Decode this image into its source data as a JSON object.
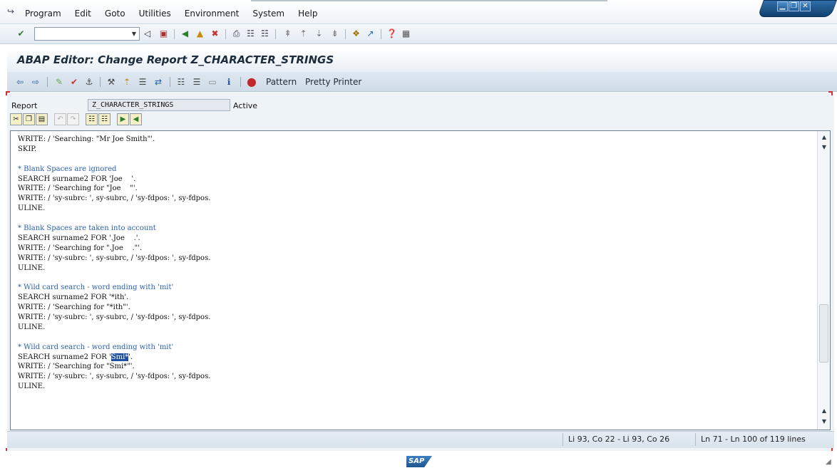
{
  "menubar": {
    "icon": "menu-exit-icon",
    "items": [
      {
        "label": "Program"
      },
      {
        "label": "Edit"
      },
      {
        "label": "Goto"
      },
      {
        "label": "Utilities"
      },
      {
        "label": "Environment"
      },
      {
        "label": "System"
      },
      {
        "label": "Help"
      }
    ],
    "window_buttons": [
      "minimize-icon",
      "restore-icon",
      "close-icon"
    ]
  },
  "standard_toolbar": {
    "command_field_value": "",
    "icons": [
      "enter-icon",
      "dropdown-icon",
      "back-triangle-icon",
      "save-icon",
      "back-icon",
      "exit-icon",
      "cancel-icon",
      "print-icon",
      "find-icon",
      "find-next-icon",
      "first-page-icon",
      "previous-page-icon",
      "next-page-icon",
      "last-page-icon",
      "new-session-icon",
      "shortcut-icon",
      "help-icon",
      "layout-icon"
    ]
  },
  "title": "ABAP Editor: Change Report Z_CHARACTER_STRINGS",
  "app_toolbar": {
    "icons": [
      "back-arrow-icon",
      "forward-arrow-icon",
      "display-change-icon",
      "check-icon",
      "activate-icon",
      "test-icon",
      "where-used-icon",
      "object-list-icon",
      "navigation-window-icon",
      "hierarchy-icon",
      "screen-icon",
      "info-icon",
      "stop-icon"
    ],
    "pattern_label": "Pattern",
    "pretty_printer_label": "Pretty Printer"
  },
  "report": {
    "label": "Report",
    "value": "Z_CHARACTER_STRINGS",
    "status": "Active"
  },
  "editor_buttons": [
    "cut-icon",
    "copy-icon",
    "paste-icon",
    "undo-icon",
    "redo-icon",
    "find-icon",
    "find-replace-icon",
    "insert-line-icon",
    "delete-line-icon"
  ],
  "code_lines": [
    {
      "text": "WRITE: / 'Searching: \"Mr Joe Smith\"'.",
      "type": "code"
    },
    {
      "text": "SKIP.",
      "type": "code"
    },
    {
      "text": "",
      "type": "code"
    },
    {
      "text": "* Blank Spaces are ignored",
      "type": "comment"
    },
    {
      "text": "SEARCH surname2 FOR 'Joe    '.",
      "type": "code"
    },
    {
      "text": "WRITE: / 'Searching for \"Joe    \"'.",
      "type": "code"
    },
    {
      "text": "WRITE: / 'sy-subrc: ', sy-subrc, / 'sy-fdpos: ', sy-fdpos.",
      "type": "code"
    },
    {
      "text": "ULINE.",
      "type": "code"
    },
    {
      "text": "",
      "type": "code"
    },
    {
      "text": "* Blank Spaces are taken into account",
      "type": "comment"
    },
    {
      "text": "SEARCH surname2 FOR '.Joe    .'.",
      "type": "code"
    },
    {
      "text": "WRITE: / 'Searching for \".Joe    .\"'.",
      "type": "code"
    },
    {
      "text": "WRITE: / 'sy-subrc: ', sy-subrc, / 'sy-fdpos: ', sy-fdpos.",
      "type": "code"
    },
    {
      "text": "ULINE.",
      "type": "code"
    },
    {
      "text": "",
      "type": "code"
    },
    {
      "text": "* Wild card search - word ending with 'mit'",
      "type": "comment"
    },
    {
      "text": "SEARCH surname2 FOR '*ith'.",
      "type": "code"
    },
    {
      "text": "WRITE: / 'Searching for \"*ith\"'.",
      "type": "code"
    },
    {
      "text": "WRITE: / 'sy-subrc: ', sy-subrc, / 'sy-fdpos: ', sy-fdpos.",
      "type": "code"
    },
    {
      "text": "ULINE.",
      "type": "code"
    },
    {
      "text": "",
      "type": "code"
    },
    {
      "text": "* Wild card search - word ending with 'mit'",
      "type": "comment"
    },
    {
      "text": "SEARCH surname2 FOR '",
      "after": "'.",
      "selected": "Smi*",
      "type": "code"
    },
    {
      "text": "WRITE: / 'Searching for \"Smi*\"'.",
      "type": "code"
    },
    {
      "text": "WRITE: / 'sy-subrc: ', sy-subrc, / 'sy-fdpos: ', sy-fdpos.",
      "type": "code"
    },
    {
      "text": "ULINE.",
      "type": "code"
    }
  ],
  "status": {
    "cursor_position": "Li 93, Co 22 - Li 93, Co 26",
    "line_range": "Ln 71 - Ln 100 of 119 lines"
  },
  "footer": {
    "logo_text": "SAP"
  }
}
